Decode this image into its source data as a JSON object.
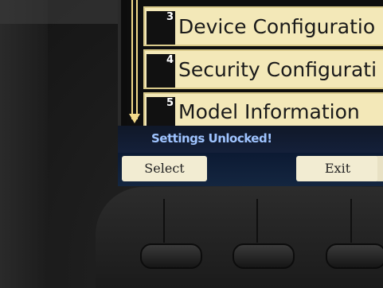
{
  "menu": {
    "items": [
      {
        "number": "3",
        "label": "Device Configuratio"
      },
      {
        "number": "4",
        "label": "Security Configurati"
      },
      {
        "number": "5",
        "label": "Model Information"
      }
    ]
  },
  "status": {
    "message": "Settings Unlocked!"
  },
  "softkeys": {
    "left": "Select",
    "right": "Exit"
  }
}
